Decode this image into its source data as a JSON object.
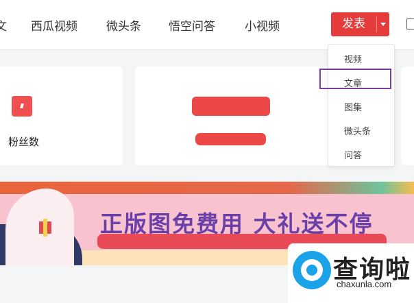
{
  "nav": {
    "left_edge": "文",
    "items": [
      "西瓜视频",
      "微头条",
      "悟空问答",
      "小视频"
    ]
  },
  "publish": {
    "label": "发表"
  },
  "dropdown": {
    "items": [
      "视频",
      "文章",
      "图集",
      "微头条",
      "问答"
    ],
    "highlighted": "文章"
  },
  "stats": {
    "fans_label": "粉丝数"
  },
  "banner": {
    "title": "正版图免费用  大礼送不停"
  },
  "watermark": {
    "brand": "查询啦",
    "url": "chaxunla.com",
    "icon": "magnifier-q-icon"
  },
  "colors": {
    "accent_red": "#e53b3b",
    "highlight_purple": "#7b3fa3",
    "watermark_blue": "#1aa3e8"
  }
}
